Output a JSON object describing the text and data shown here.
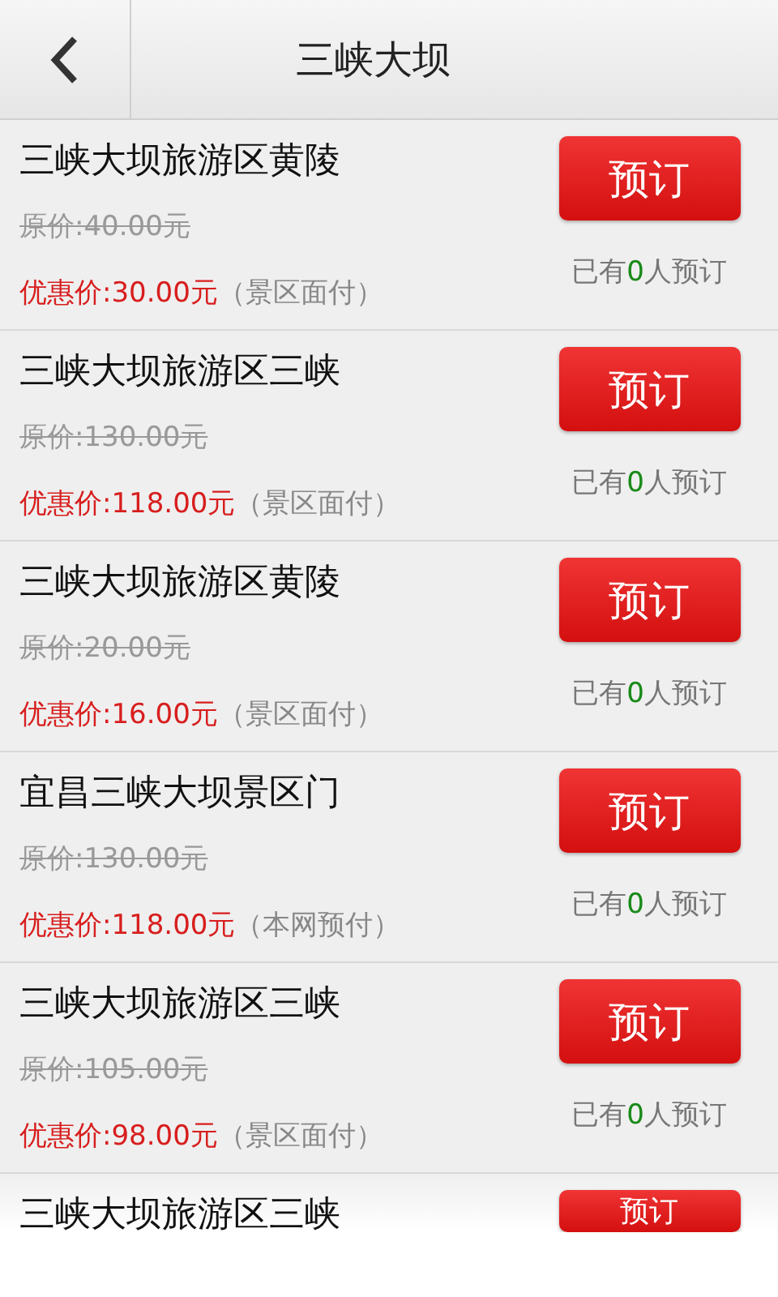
{
  "header": {
    "title": "三峡大坝"
  },
  "items": [
    {
      "name": "三峡大坝旅游区黄陵",
      "original_price": "原价:40.00元",
      "discount_price": "优惠价:30.00元",
      "payment_note": "（景区面付）",
      "button": "预订",
      "booked_prefix": "已有",
      "booked_count": "0",
      "booked_suffix": "人预订"
    },
    {
      "name": "三峡大坝旅游区三峡",
      "original_price": "原价:130.00元",
      "discount_price": "优惠价:118.00元",
      "payment_note": "（景区面付）",
      "button": "预订",
      "booked_prefix": "已有",
      "booked_count": "0",
      "booked_suffix": "人预订"
    },
    {
      "name": "三峡大坝旅游区黄陵",
      "original_price": "原价:20.00元",
      "discount_price": "优惠价:16.00元",
      "payment_note": "（景区面付）",
      "button": "预订",
      "booked_prefix": "已有",
      "booked_count": "0",
      "booked_suffix": "人预订"
    },
    {
      "name": "宜昌三峡大坝景区门",
      "original_price": "原价:130.00元",
      "discount_price": "优惠价:118.00元",
      "payment_note": "（本网预付）",
      "button": "预订",
      "booked_prefix": "已有",
      "booked_count": "0",
      "booked_suffix": "人预订"
    },
    {
      "name": "三峡大坝旅游区三峡",
      "original_price": "原价:105.00元",
      "discount_price": "优惠价:98.00元",
      "payment_note": "（景区面付）",
      "button": "预订",
      "booked_prefix": "已有",
      "booked_count": "0",
      "booked_suffix": "人预订"
    },
    {
      "name": "三峡大坝旅游区三峡",
      "button": "预订"
    }
  ]
}
